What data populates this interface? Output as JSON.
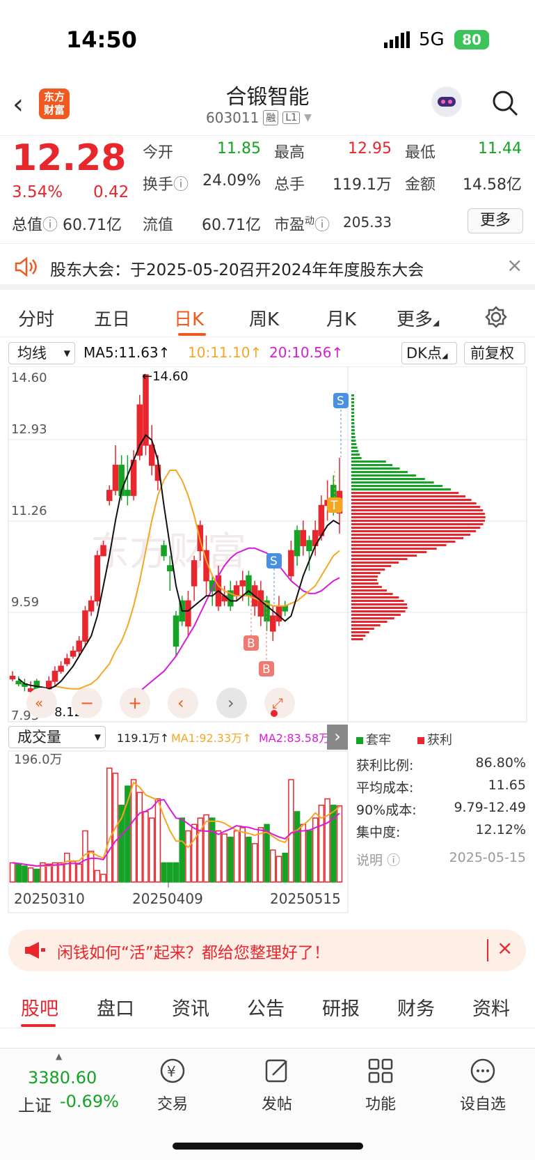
{
  "status": {
    "time": "14:50",
    "network": "5G",
    "battery": "80"
  },
  "header": {
    "logo": "东方财富",
    "name": "合锻智能",
    "code": "603011",
    "tags": [
      "融",
      "L1"
    ]
  },
  "quote": {
    "price": "12.28",
    "pct": "3.54%",
    "change": "0.42",
    "open_label": "今开",
    "open": "11.85",
    "high_label": "最高",
    "high": "12.95",
    "low_label": "最低",
    "low": "11.44",
    "turnover_label": "换手",
    "turnover": "24.09%",
    "vol_label": "总手",
    "vol": "119.1万",
    "amt_label": "金额",
    "amt": "14.58亿",
    "mktcap_label": "总值",
    "mktcap": "60.71亿",
    "float_label": "流值",
    "float": "60.71亿",
    "pe_label": "市盈",
    "pe_sup": "动",
    "pe": "205.33",
    "more": "更多"
  },
  "notice": {
    "text": "股东大会：于2025-05-20召开2024年年度股东大会"
  },
  "tabs": [
    "分时",
    "五日",
    "日K",
    "周K",
    "月K",
    "更多"
  ],
  "ma_row": {
    "selector": "均线",
    "ma5": "MA5:11.63↑",
    "ma10": "10:11.10↑",
    "ma20": "20:10.56↑",
    "dk": "DK点",
    "fq": "前复权"
  },
  "chart_labels": {
    "y_ticks": [
      "14.60",
      "12.93",
      "11.26",
      "9.59",
      "7.93"
    ],
    "high_mark": "←14.60",
    "low_mark": "←8.12",
    "sig_s": "S",
    "sig_b": "B",
    "sig_t": "T",
    "watermark": "东方财富"
  },
  "vol_row": {
    "selector": "成交量",
    "vol": "119.1万↑",
    "ma1": "MA1:92.33万↑",
    "ma2": "MA2:83.58万↑",
    "y_top": "196.0万",
    "dates": [
      "20250310",
      "20250409",
      "20250515"
    ]
  },
  "chip_legend": {
    "trapped": "套牢",
    "profit": "获利"
  },
  "chip_stats": {
    "rows": [
      {
        "k": "获利比例:",
        "v": "86.80%"
      },
      {
        "k": "平均成本:",
        "v": "11.65"
      },
      {
        "k": "90%成本:",
        "v": "9.79-12.49"
      },
      {
        "k": "集中度:",
        "v": "12.12%"
      }
    ],
    "note": "说明",
    "date": "2025-05-15"
  },
  "promo": {
    "text": "闲钱如何“活”起来？都给您整理好了！"
  },
  "bottom_tabs": [
    "股吧",
    "盘口",
    "资讯",
    "公告",
    "研报",
    "财务",
    "资料"
  ],
  "bottom_bar": {
    "index_value": "3380.60",
    "index_name": "上证",
    "index_change": "-0.69%",
    "items": [
      "交易",
      "发帖",
      "功能",
      "设自选"
    ]
  },
  "colors": {
    "up": "#e8262e",
    "down": "#14a324",
    "accent": "#f05a22",
    "ma5": "#111111",
    "ma10": "#f5a623",
    "ma20": "#d81bd8"
  },
  "chart_data": {
    "type": "candlestick",
    "ylim": [
      7.93,
      14.6
    ],
    "candles": [
      [
        8.6,
        8.55,
        8.7,
        8.5
      ],
      [
        8.45,
        8.5,
        8.6,
        8.4
      ],
      [
        8.4,
        8.45,
        8.55,
        8.3
      ],
      [
        8.35,
        8.3,
        8.5,
        8.2
      ],
      [
        8.3,
        8.5,
        8.55,
        8.25
      ],
      [
        8.2,
        8.1,
        8.3,
        8.12
      ],
      [
        8.5,
        8.35,
        8.6,
        8.3
      ],
      [
        8.7,
        8.5,
        8.8,
        8.4
      ],
      [
        8.8,
        8.7,
        8.9,
        8.65
      ],
      [
        8.95,
        8.85,
        9.05,
        8.8
      ],
      [
        9.1,
        9.0,
        9.2,
        8.95
      ],
      [
        9.3,
        9.1,
        9.4,
        9.0
      ],
      [
        9.9,
        9.3,
        10.0,
        9.2
      ],
      [
        10.1,
        9.9,
        10.2,
        9.8
      ],
      [
        11.0,
        10.1,
        11.1,
        10.0
      ],
      [
        11.2,
        11.0,
        11.3,
        11.1
      ],
      [
        12.3,
        12.1,
        12.4,
        12.0
      ],
      [
        12.8,
        12.3,
        13.2,
        12.2
      ],
      [
        12.2,
        12.8,
        13.0,
        12.1
      ],
      [
        12.2,
        12.3,
        13.0,
        12.0
      ],
      [
        12.9,
        12.2,
        13.1,
        12.1
      ],
      [
        14.0,
        13.0,
        14.2,
        12.9
      ],
      [
        14.6,
        13.2,
        14.6,
        13.0
      ],
      [
        13.2,
        12.8,
        13.6,
        12.6
      ],
      [
        12.8,
        12.5,
        13.0,
        12.3
      ],
      [
        11.0,
        11.2,
        11.3,
        10.9
      ],
      [
        10.7,
        10.8,
        11.0,
        10.3
      ],
      [
        9.2,
        9.8,
        9.9,
        9.0
      ],
      [
        9.7,
        10.1,
        10.2,
        9.6
      ],
      [
        10.1,
        9.6,
        10.3,
        9.4
      ],
      [
        10.9,
        10.4,
        11.0,
        10.1
      ],
      [
        11.6,
        11.1,
        11.7,
        10.9
      ],
      [
        11.1,
        10.5,
        11.4,
        10.2
      ],
      [
        10.3,
        10.5,
        10.6,
        10.0
      ],
      [
        10.6,
        10.0,
        10.8,
        9.9
      ],
      [
        10.2,
        10.1,
        10.4,
        10.0
      ],
      [
        10.0,
        10.3,
        10.5,
        9.9
      ],
      [
        10.4,
        10.2,
        10.5,
        10.1
      ],
      [
        10.5,
        10.4,
        10.7,
        10.1
      ],
      [
        10.2,
        10.6,
        10.7,
        10.0
      ],
      [
        10.4,
        10.0,
        10.5,
        9.8
      ],
      [
        10.3,
        9.8,
        10.5,
        9.6
      ],
      [
        9.7,
        10.1,
        10.2,
        9.5
      ],
      [
        9.8,
        9.5,
        10.0,
        9.3
      ],
      [
        10.0,
        9.7,
        10.2,
        9.6
      ],
      [
        9.9,
        10.0,
        10.1,
        9.8
      ],
      [
        11.1,
        10.6,
        11.3,
        10.5
      ],
      [
        11.0,
        11.5,
        11.6,
        10.8
      ],
      [
        11.5,
        11.2,
        11.7,
        11.0
      ],
      [
        11.1,
        11.3,
        11.4,
        10.7
      ],
      [
        11.5,
        11.2,
        11.7,
        11.0
      ],
      [
        12.0,
        11.4,
        12.2,
        11.3
      ],
      [
        12.1,
        12.0,
        12.5,
        11.7
      ],
      [
        11.9,
        12.4,
        12.6,
        11.8
      ],
      [
        12.28,
        11.85,
        12.95,
        11.44
      ]
    ],
    "ma5": [
      8.55,
      8.45,
      8.42,
      8.4,
      8.38,
      8.35,
      8.4,
      8.5,
      8.65,
      8.8,
      9.0,
      9.2,
      9.4,
      9.8,
      10.4,
      11.0,
      11.7,
      12.3,
      12.6,
      12.9,
      13.2,
      13.4,
      13.3,
      12.9,
      12.0,
      11.2,
      10.4,
      9.9,
      9.9,
      10.0,
      10.1,
      10.2,
      10.2,
      10.3,
      10.2,
      10.1,
      10.1,
      10.2,
      10.3,
      10.2,
      10.1,
      10.0,
      9.9,
      9.8,
      9.7,
      9.8,
      10.2,
      10.6,
      10.9,
      11.2,
      11.4,
      11.6,
      11.7,
      11.63
    ],
    "ma10": [
      8.4,
      8.38,
      8.36,
      8.35,
      8.35,
      8.4,
      8.45,
      8.55,
      8.7,
      8.85,
      9.1,
      9.3,
      9.6,
      10.0,
      10.5,
      11.1,
      11.7,
      12.2,
      12.5,
      12.7,
      12.7,
      12.5,
      12.2,
      11.8,
      11.3,
      10.9,
      10.6,
      10.4,
      10.3,
      10.25,
      10.2,
      10.2,
      10.2,
      10.15,
      10.1,
      10.05,
      10.0,
      10.0,
      10.0,
      10.05,
      10.1,
      10.2,
      10.3,
      10.4,
      10.6,
      10.8,
      11.0,
      11.1
    ],
    "ma20": [
      8.0,
      8.1,
      8.2,
      8.3,
      8.4,
      8.5,
      8.6,
      8.7,
      8.85,
      9.0,
      9.2,
      9.4,
      9.6,
      9.85,
      10.1,
      10.35,
      10.6,
      10.8,
      10.95,
      11.05,
      11.1,
      11.15,
      11.15,
      11.1,
      11.05,
      10.95,
      10.8,
      10.65,
      10.5,
      10.4,
      10.3,
      10.25,
      10.25,
      10.3,
      10.4,
      10.5,
      10.56
    ],
    "volume": [
      30,
      28,
      25,
      22,
      20,
      30,
      28,
      30,
      30,
      45,
      32,
      28,
      80,
      48,
      18,
      12,
      178,
      170,
      120,
      150,
      160,
      140,
      110,
      100,
      130,
      30,
      30,
      30,
      100,
      80,
      90,
      100,
      105,
      100,
      80,
      75,
      70,
      80,
      85,
      70,
      60,
      85,
      90,
      50,
      40,
      45,
      160,
      110,
      90,
      80,
      100,
      120,
      130,
      120,
      119.1
    ]
  }
}
